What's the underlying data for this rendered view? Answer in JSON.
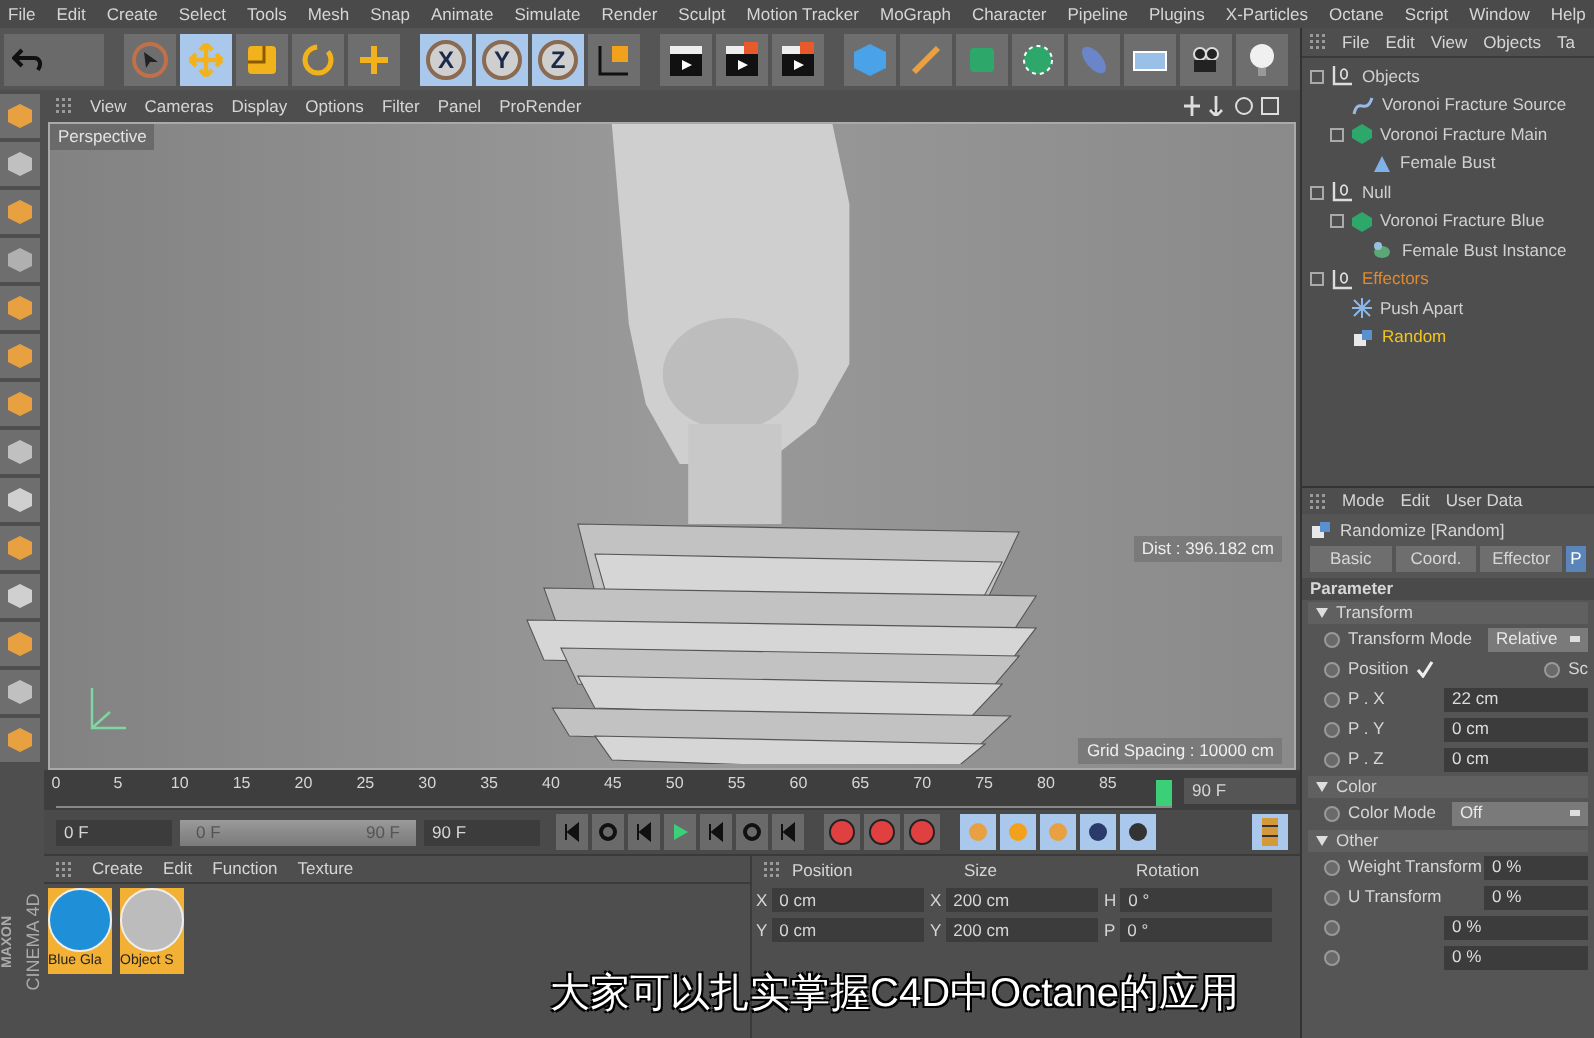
{
  "menu_bar": [
    "File",
    "Edit",
    "Create",
    "Select",
    "Tools",
    "Mesh",
    "Snap",
    "Animate",
    "Simulate",
    "Render",
    "Sculpt",
    "Motion Tracker",
    "MoGraph",
    "Character",
    "Pipeline",
    "Plugins",
    "X-Particles",
    "Octane",
    "Script",
    "Window",
    "Help"
  ],
  "toolbar": {
    "tools": [
      {
        "kind": "select",
        "selected": false
      },
      {
        "kind": "move",
        "selected": true
      },
      {
        "kind": "scale",
        "selected": false
      },
      {
        "kind": "rotate",
        "selected": false
      },
      {
        "kind": "add",
        "selected": false
      }
    ],
    "axes": [
      {
        "label": "X",
        "selected": true
      },
      {
        "label": "Y",
        "selected": true
      },
      {
        "label": "Z",
        "selected": true
      }
    ]
  },
  "viewport": {
    "menu": [
      "View",
      "Cameras",
      "Display",
      "Options",
      "Filter",
      "Panel",
      "ProRender"
    ],
    "camera_label": "Perspective",
    "distance": "Dist : 396.182 cm",
    "grid_spacing": "Grid Spacing : 10000 cm"
  },
  "timeline": {
    "ticks": [
      "0",
      "5",
      "10",
      "15",
      "20",
      "25",
      "30",
      "35",
      "40",
      "45",
      "50",
      "55",
      "60",
      "65",
      "70",
      "75",
      "80",
      "85"
    ],
    "playhead": {
      "level": 1
    },
    "end_field": "90 F",
    "start_field": "0 F",
    "range_start": "0 F",
    "range_end": "90 F",
    "max_field": "90 F"
  },
  "logo": {
    "brand": "MAXON",
    "product": "CINEMA 4D"
  },
  "material_manager": {
    "menu": [
      "Create",
      "Edit",
      "Function",
      "Texture"
    ],
    "materials": [
      {
        "name": "Blue Gla",
        "kind": "blue"
      },
      {
        "name": "Object S",
        "kind": "grey"
      }
    ]
  },
  "coordinates": {
    "columns": [
      "Position",
      "Size",
      "Rotation"
    ],
    "rows": [
      [
        {
          "axis": "X",
          "value": "0 cm"
        },
        {
          "axis": "X",
          "value": "200 cm"
        },
        {
          "axis": "H",
          "value": "0 °"
        }
      ],
      [
        {
          "axis": "Y",
          "value": "0 cm"
        },
        {
          "axis": "Y",
          "value": "200 cm"
        },
        {
          "axis": "P",
          "value": "0 °"
        }
      ]
    ]
  },
  "object_manager": {
    "menu": [
      "File",
      "Edit",
      "View",
      "Objects",
      "Ta"
    ],
    "tree": [
      {
        "name": "Objects",
        "kind": "null",
        "color": "#d0d0d0",
        "children": [
          {
            "name": "Voronoi Fracture Source",
            "kind": "spline",
            "color": "#d0d0d0"
          },
          {
            "name": "Voronoi Fracture Main",
            "kind": "fracture",
            "color": "#d0d0d0",
            "children": [
              {
                "name": "Female Bust",
                "kind": "mesh",
                "color": "#d0d0d0"
              }
            ]
          }
        ]
      },
      {
        "name": "Null",
        "kind": "null",
        "color": "#d0d0d0",
        "children": [
          {
            "name": "Voronoi Fracture Blue",
            "kind": "fracture",
            "color": "#d0d0d0",
            "children": [
              {
                "name": "Female Bust Instance",
                "kind": "instance",
                "color": "#d0d0d0"
              }
            ]
          }
        ]
      },
      {
        "name": "Effectors",
        "kind": "null",
        "color": "#e0892e",
        "children": [
          {
            "name": "Push Apart",
            "kind": "push",
            "color": "#d0d0d0"
          },
          {
            "name": "Random",
            "kind": "random",
            "color": "#f5c518"
          }
        ]
      }
    ]
  },
  "attributes": {
    "menu": [
      "Mode",
      "Edit",
      "User Data"
    ],
    "object_title": "Randomize [Random]",
    "tabs": [
      {
        "label": "Basic",
        "selected": false
      },
      {
        "label": "Coord.",
        "selected": false
      },
      {
        "label": "Effector",
        "selected": false
      },
      {
        "label": "P",
        "selected": true
      }
    ],
    "heading": "Parameter",
    "sections": [
      {
        "title": "Transform",
        "rows": [
          {
            "kind": "dropdown",
            "label": "Transform Mode",
            "value": "Relative"
          },
          {
            "kind": "check",
            "label": "Position",
            "checked": true,
            "extra_label": "Sc"
          },
          {
            "kind": "number",
            "label": "P . X",
            "value": "22 cm"
          },
          {
            "kind": "number",
            "label": "P . Y",
            "value": "0 cm"
          },
          {
            "kind": "number",
            "label": "P . Z",
            "value": "0 cm"
          }
        ]
      },
      {
        "title": "Color",
        "rows": [
          {
            "kind": "dropdown",
            "label": "Color Mode",
            "value": "Off"
          }
        ]
      },
      {
        "title": "Other",
        "rows": [
          {
            "kind": "number",
            "label": "Weight Transform",
            "value": "0 %"
          },
          {
            "kind": "number",
            "label": "U Transform",
            "value": "0 %"
          },
          {
            "kind": "number",
            "value": "0 %"
          },
          {
            "kind": "number",
            "value": "0 %"
          }
        ]
      }
    ]
  },
  "subtitle": "大家可以扎实掌握C4D中Octane的应用"
}
